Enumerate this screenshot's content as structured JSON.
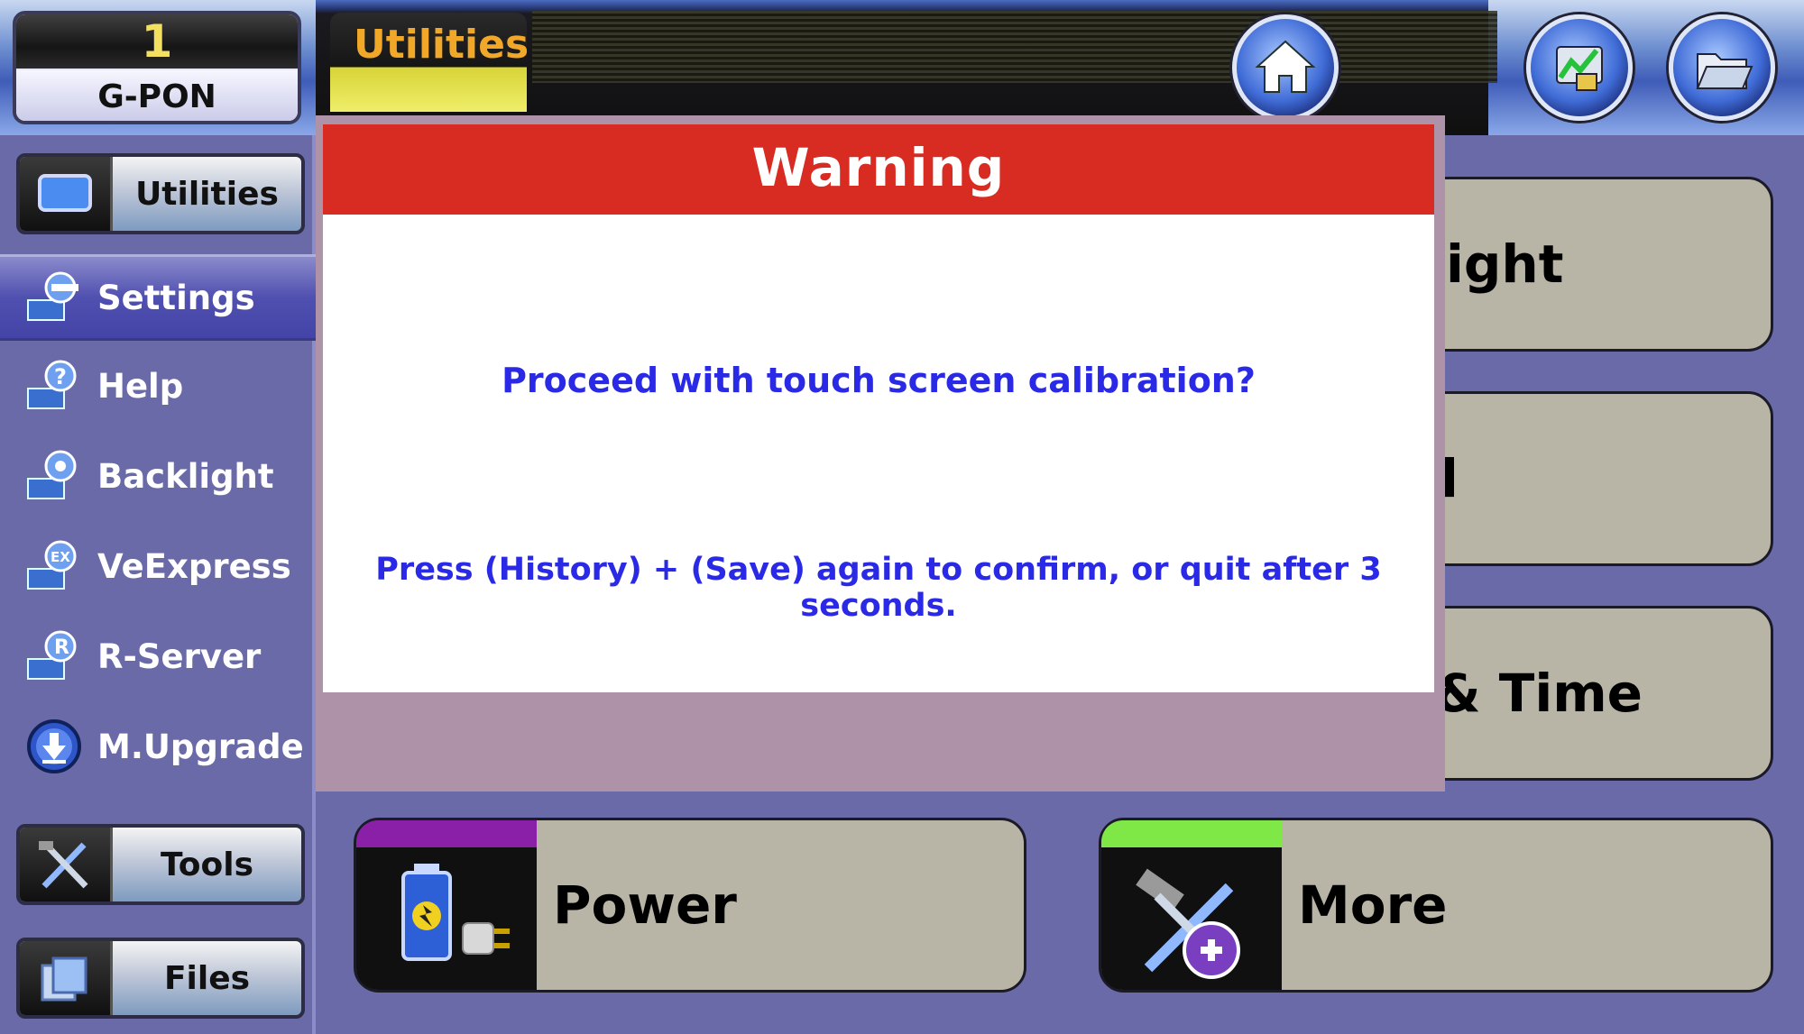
{
  "header": {
    "port_number": "1",
    "port_name": "G-PON",
    "title_tab": "Utilities",
    "home_icon": "home-icon",
    "right_icons": [
      "results-icon",
      "folder-icon"
    ]
  },
  "sidebar": {
    "categories": {
      "utilities": "Utilities",
      "tools": "Tools",
      "files": "Files"
    },
    "items": [
      {
        "label": "Settings",
        "icon": "settings-wrench-icon",
        "selected": true
      },
      {
        "label": "Help",
        "icon": "help-icon"
      },
      {
        "label": "Backlight",
        "icon": "backlight-icon"
      },
      {
        "label": "VeExpress",
        "icon": "veexpress-icon"
      },
      {
        "label": "R-Server",
        "icon": "r-server-icon"
      },
      {
        "label": "M.Upgrade",
        "icon": "download-icon"
      }
    ]
  },
  "main": {
    "tiles_partial": [
      "ight",
      "l",
      "& Time"
    ],
    "power_label": "Power",
    "more_label": "More"
  },
  "dialog": {
    "title": "Warning",
    "question": "Proceed with touch screen calibration?",
    "hint": "Press (History) + (Save) again to confirm, or quit after 3 seconds."
  },
  "colors": {
    "warning_red": "#d82b22",
    "dialog_text_blue": "#2a2ae6",
    "power_bar": "#8a1fa8",
    "more_bar": "#7fe847",
    "tab_label": "#f1a828"
  }
}
